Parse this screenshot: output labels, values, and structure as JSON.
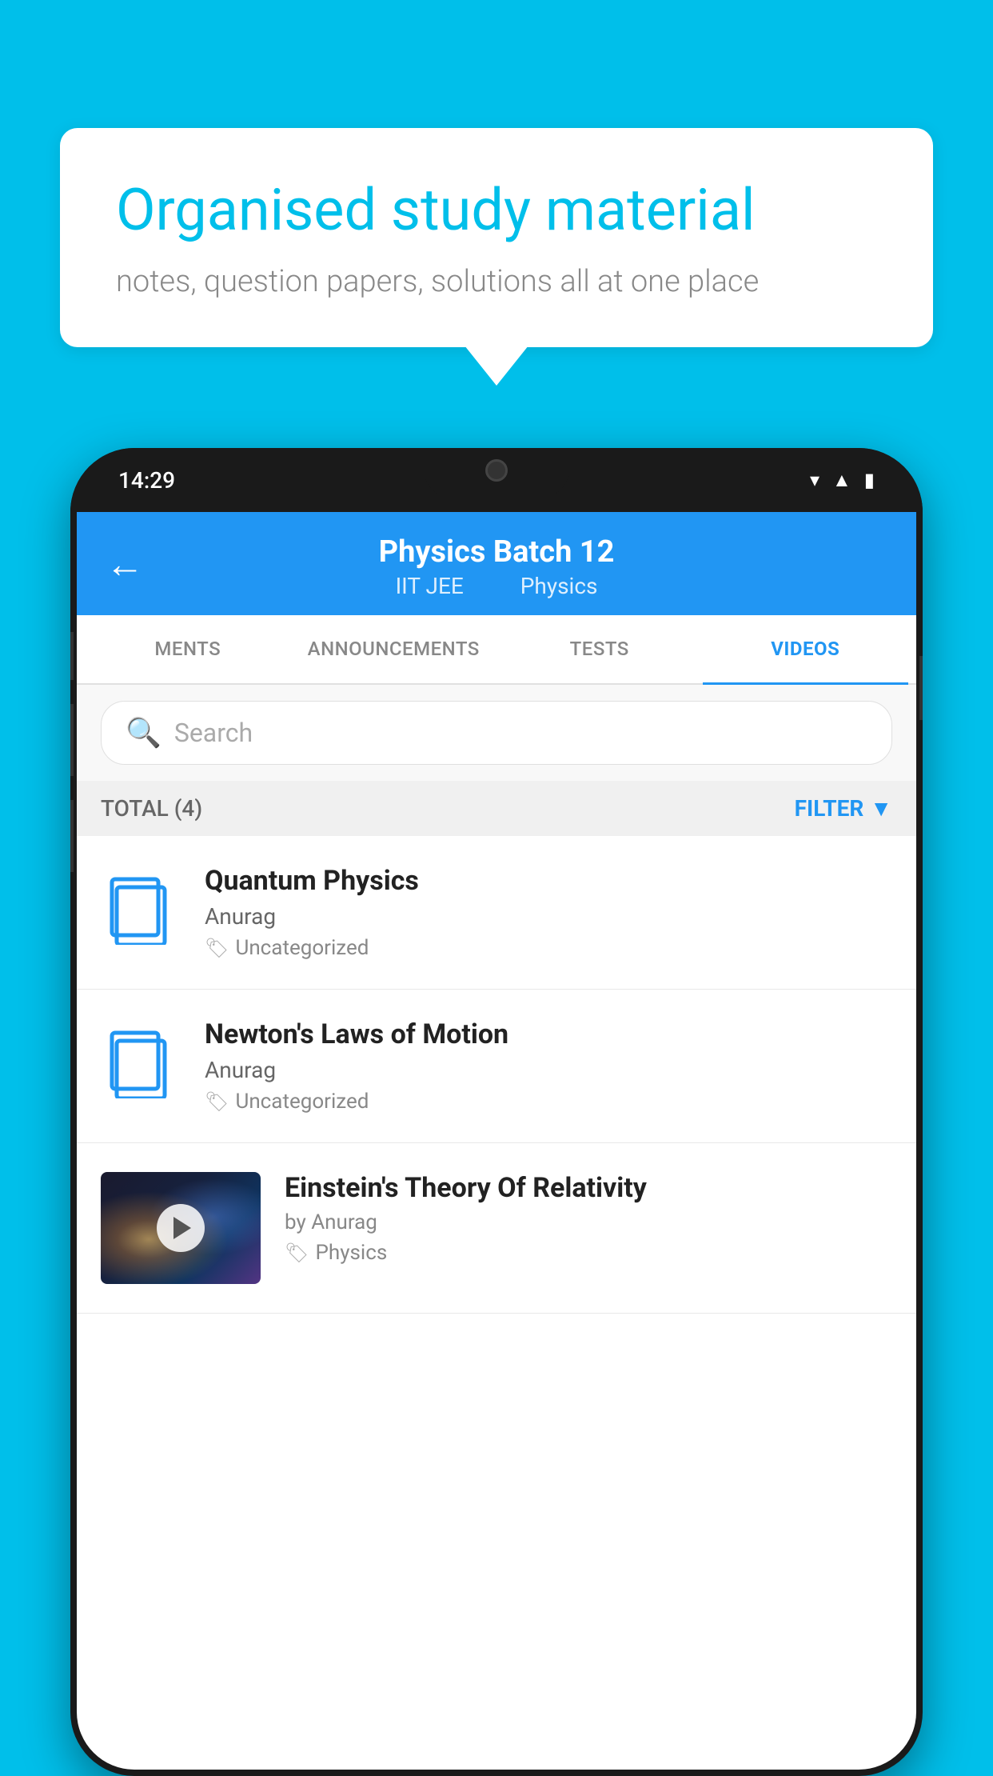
{
  "background_color": "#00BFEA",
  "speech_bubble": {
    "headline": "Organised study material",
    "subtext": "notes, question papers, solutions all at one place"
  },
  "phone": {
    "status_bar": {
      "time": "14:29",
      "icons": [
        "wifi",
        "signal",
        "battery"
      ]
    },
    "header": {
      "title": "Physics Batch 12",
      "subtitle_left": "IIT JEE",
      "subtitle_right": "Physics",
      "back_label": "←"
    },
    "tabs": [
      {
        "label": "MENTS",
        "active": false
      },
      {
        "label": "ANNOUNCEMENTS",
        "active": false
      },
      {
        "label": "TESTS",
        "active": false
      },
      {
        "label": "VIDEOS",
        "active": true
      }
    ],
    "search": {
      "placeholder": "Search"
    },
    "filter_bar": {
      "total_label": "TOTAL (4)",
      "filter_label": "FILTER"
    },
    "videos": [
      {
        "id": 1,
        "title": "Quantum Physics",
        "author": "Anurag",
        "tag": "Uncategorized",
        "has_thumbnail": false
      },
      {
        "id": 2,
        "title": "Newton's Laws of Motion",
        "author": "Anurag",
        "tag": "Uncategorized",
        "has_thumbnail": false
      },
      {
        "id": 3,
        "title": "Einstein's Theory Of Relativity",
        "author": "by Anurag",
        "tag": "Physics",
        "has_thumbnail": true
      }
    ]
  }
}
